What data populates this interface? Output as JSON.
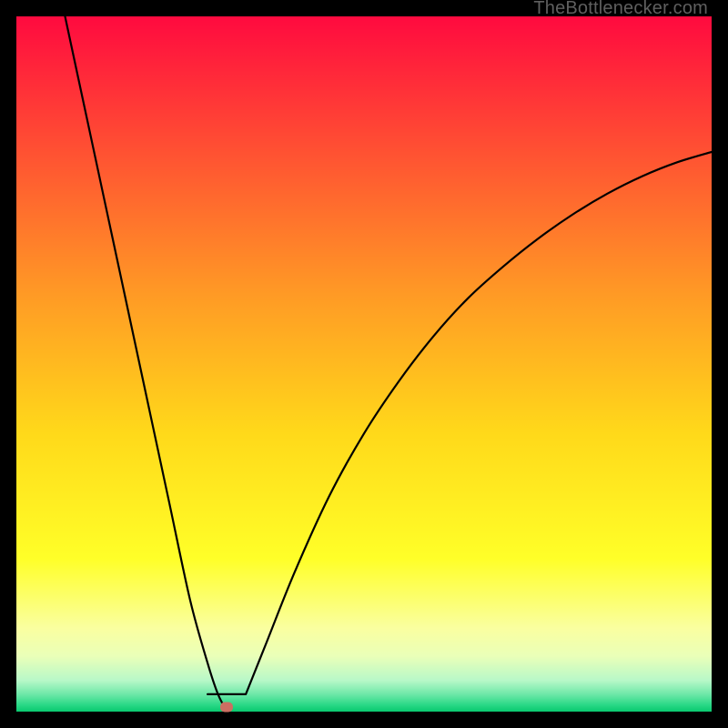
{
  "attribution": "TheBottlenecker.com",
  "marker": {
    "x_frac": 0.303,
    "y_frac": 0.994
  },
  "chart_data": {
    "type": "line",
    "title": "",
    "xlabel": "",
    "ylabel": "",
    "xlim": [
      0,
      1
    ],
    "ylim": [
      0,
      1
    ],
    "background": "rainbow-gradient",
    "notch": {
      "x": 0.303,
      "y": 1.0
    },
    "series": [
      {
        "name": "left-branch",
        "x": [
          0.07,
          0.1,
          0.13,
          0.16,
          0.19,
          0.22,
          0.25,
          0.275,
          0.29,
          0.303
        ],
        "y": [
          0.0,
          0.14,
          0.28,
          0.42,
          0.56,
          0.7,
          0.84,
          0.93,
          0.975,
          1.0
        ]
      },
      {
        "name": "flat-notch",
        "x": [
          0.275,
          0.33
        ],
        "y": [
          0.975,
          0.975
        ]
      },
      {
        "name": "right-branch",
        "x": [
          0.33,
          0.36,
          0.4,
          0.45,
          0.5,
          0.55,
          0.6,
          0.65,
          0.7,
          0.75,
          0.8,
          0.85,
          0.9,
          0.95,
          1.0
        ],
        "y": [
          0.975,
          0.9,
          0.8,
          0.69,
          0.6,
          0.525,
          0.46,
          0.405,
          0.36,
          0.32,
          0.285,
          0.255,
          0.23,
          0.21,
          0.195
        ]
      }
    ],
    "gradient_stops": [
      {
        "pos": 0.0,
        "color": "#ff0a3f"
      },
      {
        "pos": 0.2,
        "color": "#ff5332"
      },
      {
        "pos": 0.4,
        "color": "#ff9a25"
      },
      {
        "pos": 0.6,
        "color": "#ffd91a"
      },
      {
        "pos": 0.78,
        "color": "#ffff28"
      },
      {
        "pos": 0.88,
        "color": "#faffa0"
      },
      {
        "pos": 0.92,
        "color": "#eaffb8"
      },
      {
        "pos": 0.955,
        "color": "#b8f8c8"
      },
      {
        "pos": 0.975,
        "color": "#6ee8a8"
      },
      {
        "pos": 0.99,
        "color": "#2bd987"
      },
      {
        "pos": 1.0,
        "color": "#09c96f"
      }
    ]
  }
}
